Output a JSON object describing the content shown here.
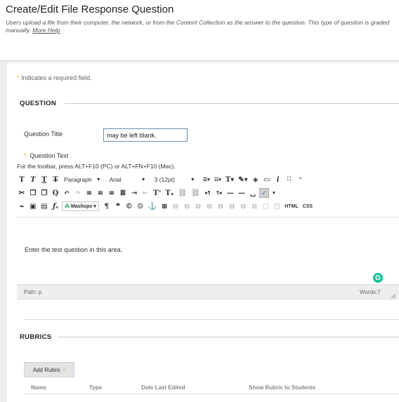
{
  "page": {
    "title": "Create/Edit File Response Question",
    "description": "Users upload a file from their computer, the network, or from the Content Collection as the answer to the question. This type of question is graded",
    "description_line2": "manually.",
    "more_help": "More Help"
  },
  "form": {
    "required_star": "*",
    "required_note": "Indicates a required field.",
    "question_section": "QUESTION",
    "question_title_label": "Question Title",
    "question_title_value": "may be left blank.",
    "question_text_label": "Question Text",
    "toolbar_hint": "For the toolbar, press ALT+F10 (PC) or ALT+FN+F10 (Mac)."
  },
  "toolbar": {
    "paragraph": "Paragraph",
    "font": "Arial",
    "size": "3 (12pt)",
    "mashups": "Mashups",
    "html": "HTML",
    "css": "CSS"
  },
  "editor": {
    "body_text": "Enter the test question in this area.",
    "path_label": "Path: p",
    "word_count": "Words:7",
    "grammarly": "G"
  },
  "rubrics": {
    "section": "RUBRICS",
    "add_button": "Add Rubric",
    "chevron": "»",
    "columns": [
      "Name",
      "Type",
      "Date Last Edited",
      "Show Rubric to Students"
    ]
  },
  "colors": {
    "accent": "#e8a33d",
    "grammarly": "#15c39a",
    "input_border": "#6b8cb8"
  }
}
